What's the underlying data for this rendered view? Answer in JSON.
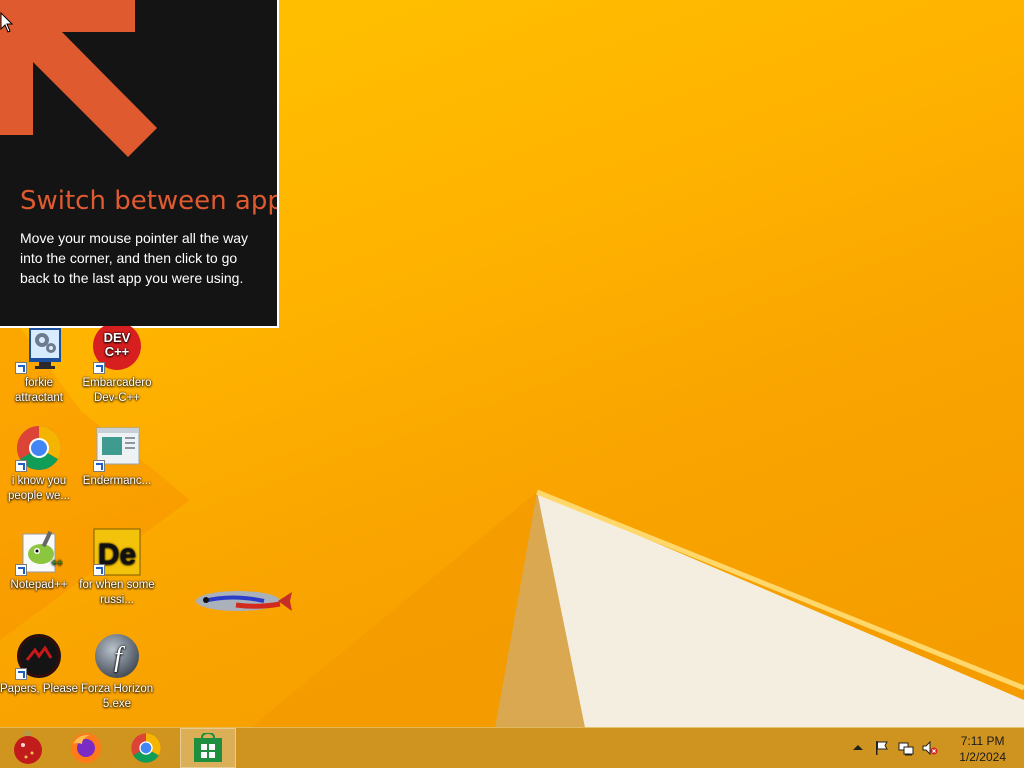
{
  "tip": {
    "title": "Switch between apps",
    "body": "Move your mouse pointer all the way into the corner, and then click to go back to the last app you were using."
  },
  "desktop_icons": [
    {
      "label": "forkie attractant"
    },
    {
      "label": "Embarcadero Dev-C++",
      "badge": "DEV C++"
    },
    {
      "label": "i know you people we..."
    },
    {
      "label": "Endermanc..."
    },
    {
      "label": "Notepad++"
    },
    {
      "label": "for when some russi...",
      "badge": "De"
    },
    {
      "label": "Papers, Please"
    },
    {
      "label": "Forza Horizon 5.exe",
      "badge": "f"
    }
  ],
  "taskbar": {
    "pinned": [
      "christmas-ornament",
      "firefox",
      "chrome",
      "store"
    ],
    "clock": {
      "time": "7:11 PM",
      "date": "1/2/2024"
    }
  },
  "colors": {
    "accent": "#e05a30",
    "wallpaper": "#ffb300"
  }
}
